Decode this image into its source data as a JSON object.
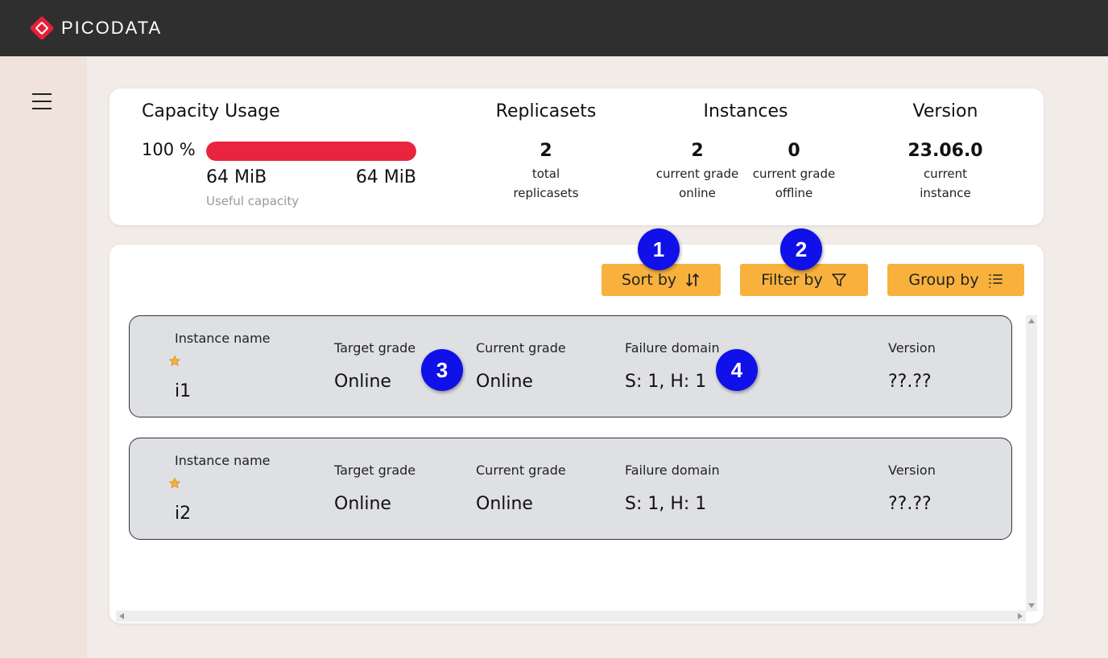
{
  "header": {
    "brand": "PICODATA"
  },
  "capacity": {
    "title": "Capacity Usage",
    "percent_label": "100 %",
    "percent_value": 100,
    "used": "64 MiB",
    "total": "64 MiB",
    "sublabel": "Useful capacity",
    "bar_color": "#e8243f"
  },
  "replicasets": {
    "title": "Replicasets",
    "count": "2",
    "label": "total replicasets"
  },
  "instances": {
    "title": "Instances",
    "online_count": "2",
    "online_label": "current grade online",
    "offline_count": "0",
    "offline_label": "current grade offline"
  },
  "version": {
    "title": "Version",
    "value": "23.06.0",
    "label": "current instance"
  },
  "toolbar": {
    "sort_label": "Sort by",
    "filter_label": "Filter by",
    "group_label": "Group by",
    "accent": "#f8b13d"
  },
  "columns": {
    "name": "Instance name",
    "target": "Target grade",
    "current": "Current grade",
    "failure": "Failure domain",
    "version": "Version"
  },
  "rows": [
    {
      "name": "i1",
      "target": "Online",
      "current": "Online",
      "failure": "S: 1, H: 1",
      "version": "??.??"
    },
    {
      "name": "i2",
      "target": "Online",
      "current": "Online",
      "failure": "S: 1, H: 1",
      "version": "??.??"
    }
  ],
  "badges": [
    "1",
    "2",
    "3",
    "4"
  ]
}
